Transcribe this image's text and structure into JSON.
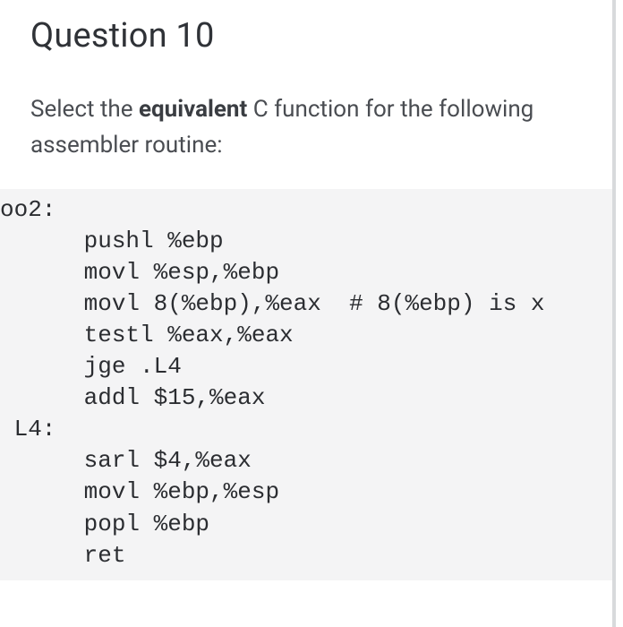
{
  "question": {
    "title": "Question 10",
    "prompt_pre": "Select the ",
    "prompt_strong": "equivalent",
    "prompt_post": " C function for the following assembler routine:"
  },
  "code": "oo2:\n      pushl %ebp\n      movl %esp,%ebp\n      movl 8(%ebp),%eax  # 8(%ebp) is x\n      testl %eax,%eax\n      jge .L4\n      addl $15,%eax\n L4:\n      sarl $4,%eax\n      movl %ebp,%esp\n      popl %ebp\n      ret"
}
